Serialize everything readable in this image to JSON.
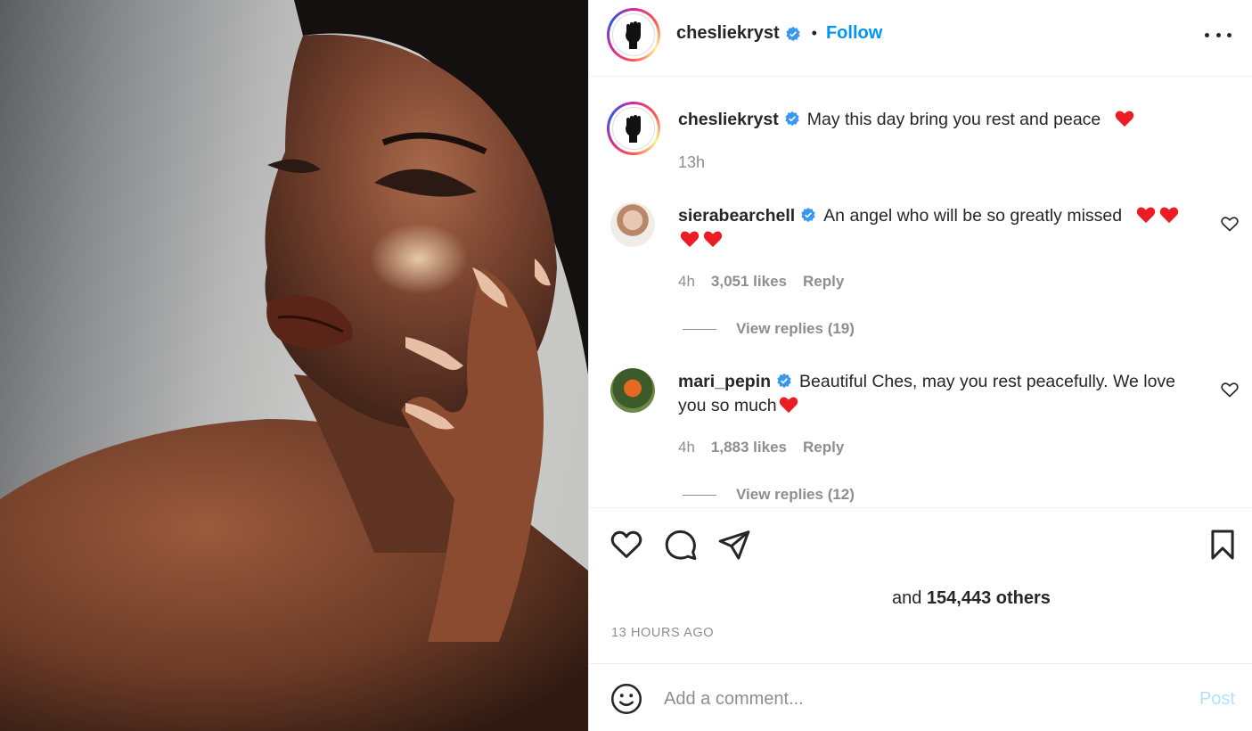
{
  "post": {
    "username": "chesliekryst",
    "follow_label": "Follow",
    "separator": "•"
  },
  "caption": {
    "username": "chesliekryst",
    "text": "May this day bring you rest and peace",
    "time": "13h"
  },
  "comments": [
    {
      "username": "sierabearchell",
      "text": "An angel who will be so greatly missed",
      "time": "4h",
      "likes": "3,051 likes",
      "reply_label": "Reply",
      "view_replies": "View replies (19)"
    },
    {
      "username": "mari_pepin",
      "text": "Beautiful Ches, may you rest peacefully. We love you so much",
      "time": "4h",
      "likes": "1,883 likes",
      "reply_label": "Reply",
      "view_replies": "View replies (12)"
    }
  ],
  "likes_summary": {
    "prefix": "and",
    "count": "154,443 others"
  },
  "timestamp": "13 HOURS AGO",
  "add_comment": {
    "placeholder": "Add a comment...",
    "post_label": "Post"
  },
  "colors": {
    "link": "#0095f6",
    "verified": "#3897f0",
    "heart": "#ed1b24",
    "post_disabled": "#b2dffc"
  }
}
